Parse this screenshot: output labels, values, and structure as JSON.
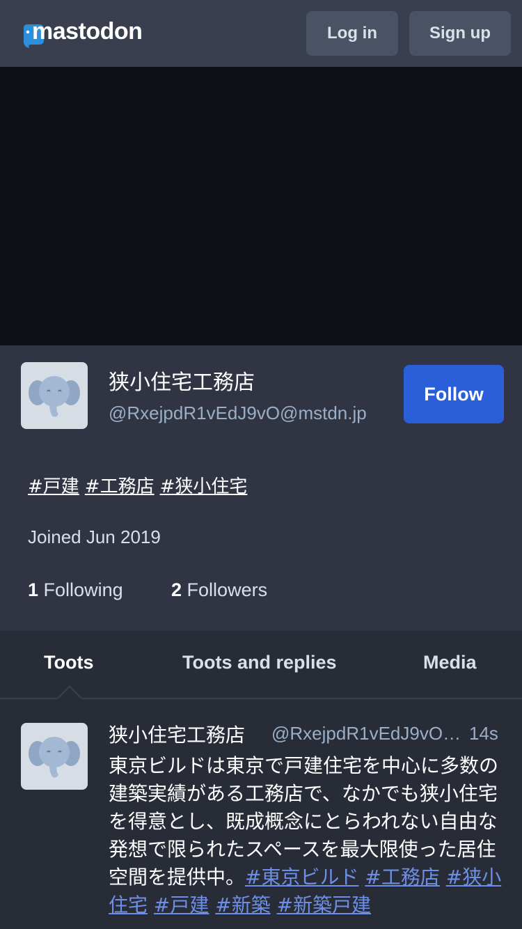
{
  "header": {
    "logo_text": "mastodon",
    "login_label": "Log in",
    "signup_label": "Sign up"
  },
  "profile": {
    "display_name": "狭小住宅工務店",
    "acct": "@RxejpdR1vEdJ9vO@mstdn.jp",
    "follow_label": "Follow",
    "bio_tags": [
      "#戸建",
      "#工務店",
      "#狭小住宅"
    ],
    "joined": "Joined Jun 2019",
    "following_count": "1",
    "following_label": "Following",
    "followers_count": "2",
    "followers_label": "Followers"
  },
  "tabs": [
    {
      "label": "Toots",
      "active": true
    },
    {
      "label": "Toots and replies",
      "active": false
    },
    {
      "label": "Media",
      "active": false
    }
  ],
  "status": {
    "display_name": "狭小住宅工務店",
    "acct": "@RxejpdR1vEdJ9vO@mstdn.jp",
    "time": "14s",
    "text": "東京ビルドは東京で戸建住宅を中心に多数の建築実績がある工務店で、なかでも狭小住宅を得意とし、既成概念にとらわれない自由な発想で限られたスペースを最大限使った居住空間を提供中。",
    "hashtags": [
      "#東京ビルド",
      "#工務店",
      "#狭小住宅",
      "#戸建",
      "#新築",
      "#新築戸建"
    ]
  },
  "colors": {
    "accent": "#2b5fd9",
    "background": "#313543",
    "header": "#393f4f",
    "link": "#6d8fe8"
  }
}
